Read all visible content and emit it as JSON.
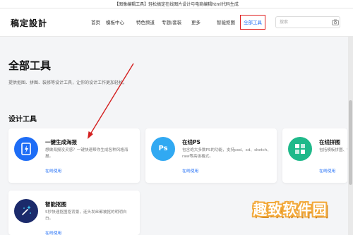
{
  "titlebar": {
    "text": "【图像编辑工具】轻松搞定在线图片设计与电商编辑html代码生成"
  },
  "header": {
    "logo": "稿定設計",
    "nav": [
      "首页",
      "模板中心",
      "特色频道",
      "专题/套装",
      "更多",
      "智能抠图",
      "全部工具"
    ],
    "active_index": 6,
    "search": {
      "placeholder": "搜索",
      "value": ""
    },
    "icons": {
      "search_camera": "camera-icon"
    }
  },
  "main": {
    "title": "全部工具",
    "description": "提供抠图、拼图、装修等设计工具，让你的设计工作更加轻松。",
    "section_title": "设计工具",
    "cards": [
      {
        "title": "一键生成海报",
        "desc": "想做海报没灵感？一键快速帮你生成各种风格海报。",
        "link": "在线使用",
        "icon": "poster-icon",
        "icon_color": "#1e6df6"
      },
      {
        "title": "在线PS",
        "desc": "包含绝大多数PS的功能，支持psd、xd、sketch、raw等高级格式。",
        "link": "在线使用",
        "icon": "ps-icon",
        "icon_color": "#31a9f2",
        "glyph": "Ps"
      },
      {
        "title": "在线拼图",
        "desc": "包括模板拼图、快速拼图、自由拼图",
        "link": "在线使用",
        "icon": "collage-icon",
        "icon_color": "#1fb98a"
      },
      {
        "title": "智能抠图",
        "desc": "5秒快速抠图抠背景，连头发丝都被抠的明明白白。",
        "link": "在线使用",
        "icon": "magic-wand-icon",
        "icon_color": "#1b2a6b"
      }
    ]
  },
  "watermark": {
    "text": "趣致软件园"
  },
  "colors": {
    "accent": "#1e6df6",
    "highlight": "#e02020",
    "background": "#f4f5f7"
  }
}
